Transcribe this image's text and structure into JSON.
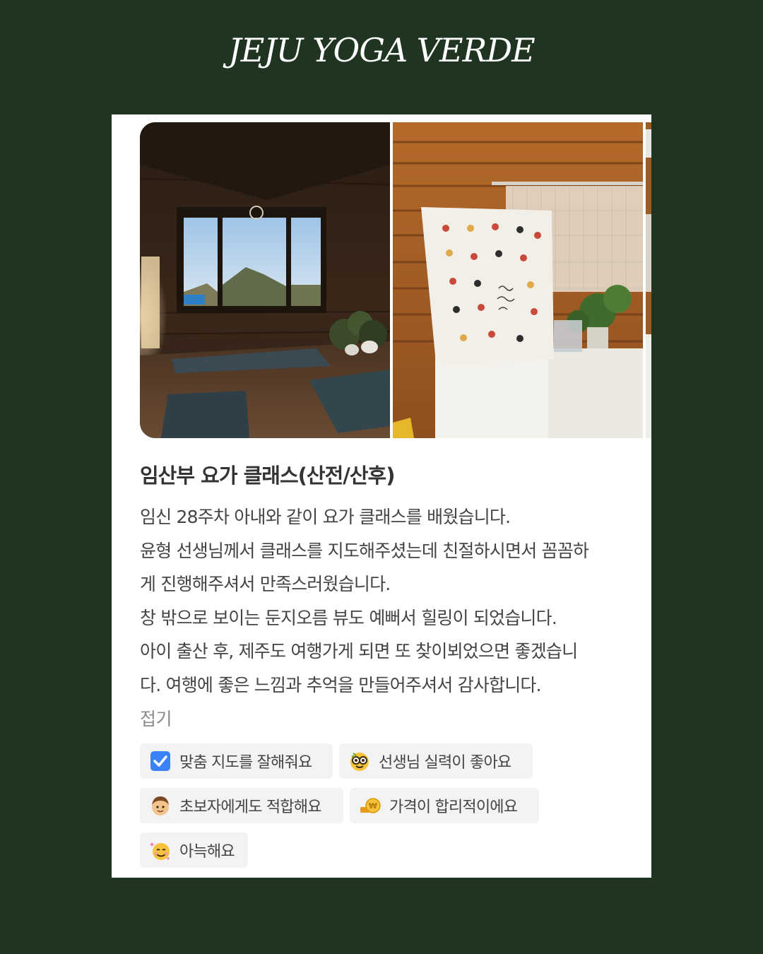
{
  "brand": {
    "title": "JEJU YOGA VERDE"
  },
  "review_card": {
    "title": "임산부 요가 클래스(산전/산후)",
    "lines": [
      "임신 28주차 아내와 같이 요가 클래스를 배웠습니다.",
      "윤형 선생님께서 클래스를 지도해주셨는데 친절하시면서 꼼꼼하",
      "게 진행해주셔서 만족스러웠습니다.",
      "창 밖으로 보이는 둔지오름 뷰도 예뻐서 힐링이 되었습니다.",
      "아이 출산 후, 제주도 여행가게 되면 또 찾이뵈었으면 좋겠습니",
      "다. 여행에 좋은 느낌과 추억을 만들어주셔서 감사합니다."
    ],
    "fold_label": "접기",
    "photos": [
      {
        "name": "yoga-room-window-photo"
      },
      {
        "name": "yoga-towel-photo"
      },
      {
        "name": "partial-photo"
      }
    ],
    "tags": [
      {
        "icon": "check-box-icon",
        "label": "맞춤 지도를 잘해줘요"
      },
      {
        "icon": "nerd-face-icon",
        "label": "선생님 실력이 좋아요"
      },
      {
        "icon": "child-face-icon",
        "label": "초보자에게도 적합해요"
      },
      {
        "icon": "coin-icon",
        "label": "가격이 합리적이에요"
      },
      {
        "icon": "smiling-face-icon",
        "label": "아늑해요"
      }
    ]
  },
  "colors": {
    "background": "#203521",
    "card": "#ffffff",
    "chip": "#f3f3f3",
    "check_blue": "#3b82f6"
  }
}
